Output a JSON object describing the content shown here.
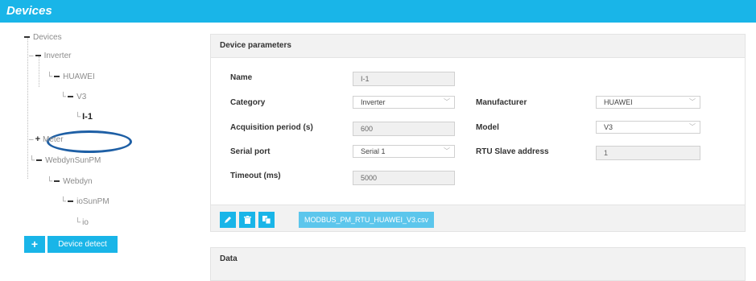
{
  "header": {
    "title": "Devices"
  },
  "tree": {
    "root": "Devices",
    "inverter": "Inverter",
    "huawei": "HUAWEI",
    "v3": "V3",
    "selected": "I-1",
    "meter": "Meter",
    "webdynsunpm": "WebdynSunPM",
    "webdyn": "Webdyn",
    "iosunpm": "ioSunPM",
    "io": "io"
  },
  "actions": {
    "add_label": "+",
    "detect_label": "Device detect"
  },
  "params": {
    "title": "Device parameters",
    "name_label": "Name",
    "name_value": "I-1",
    "category_label": "Category",
    "category_value": "Inverter",
    "acq_label": "Acquisition period (s)",
    "acq_value": "600",
    "serial_label": "Serial port",
    "serial_value": "Serial 1",
    "timeout_label": "Timeout (ms)",
    "timeout_value": "5000",
    "manufacturer_label": "Manufacturer",
    "manufacturer_value": "HUAWEI",
    "model_label": "Model",
    "model_value": "V3",
    "rtu_label": "RTU Slave address",
    "rtu_value": "1",
    "file_label": "MODBUS_PM_RTU_HUAWEI_V3.csv"
  },
  "data_panel": {
    "title": "Data"
  },
  "colors": {
    "accent": "#19b5e8",
    "highlight_ellipse": "#1e5fa5"
  }
}
